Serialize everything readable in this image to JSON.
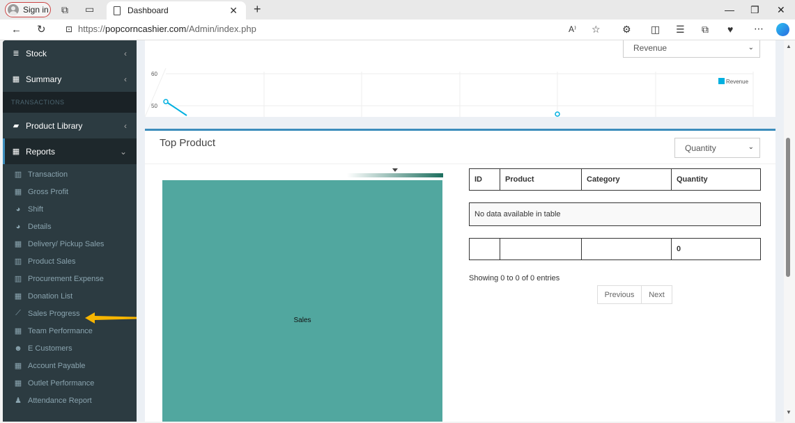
{
  "browser": {
    "sign_in_label": "Sign in",
    "tab_title": "Dashboard",
    "new_tab_symbol": "+",
    "url_prefix": "https://",
    "url_domain": "popcorncashier.com",
    "url_path": "/Admin/index.php"
  },
  "sidebar": {
    "top_items": [
      {
        "label": "Stock",
        "icon": "database-icon"
      },
      {
        "label": "Summary",
        "icon": "table-icon"
      }
    ],
    "section_header": "TRANSACTIONS",
    "product_library": {
      "label": "Product Library",
      "icon": "book-icon"
    },
    "reports": {
      "label": "Reports",
      "icon": "table-icon"
    },
    "report_items": [
      {
        "label": "Transaction",
        "icon": "bar-chart-icon"
      },
      {
        "label": "Gross Profit",
        "icon": "table-icon"
      },
      {
        "label": "Shift",
        "icon": "pie-chart-icon"
      },
      {
        "label": "Details",
        "icon": "pie-chart-icon"
      },
      {
        "label": "Delivery/ Pickup Sales",
        "icon": "table-icon"
      },
      {
        "label": "Product Sales",
        "icon": "bar-chart-icon"
      },
      {
        "label": "Procurement Expense",
        "icon": "bar-chart-icon"
      },
      {
        "label": "Donation List",
        "icon": "table-icon"
      },
      {
        "label": "Sales Progress",
        "icon": "line-chart-icon"
      },
      {
        "label": "Team Performance",
        "icon": "table-icon"
      },
      {
        "label": "E Customers",
        "icon": "users-icon"
      },
      {
        "label": "Account Payable",
        "icon": "table-icon"
      },
      {
        "label": "Outlet Performance",
        "icon": "table-icon"
      },
      {
        "label": "Attendance Report",
        "icon": "person-icon"
      }
    ]
  },
  "revenue_panel": {
    "select_value": "Revenue",
    "legend_label": "Revenue",
    "y_ticks": [
      "60",
      "50"
    ],
    "colors": {
      "line": "#00b0e0"
    }
  },
  "top_product": {
    "title": "Top Product",
    "select_value": "Quantity",
    "treemap_label": "Sales",
    "treemap_color": "#51a79f",
    "table": {
      "headers": [
        "ID",
        "Product",
        "Category",
        "Quantity"
      ],
      "empty_message": "No data available in table",
      "footer_row": [
        "",
        "",
        "",
        "0"
      ]
    },
    "info": "Showing 0 to 0 of 0 entries",
    "previous_label": "Previous",
    "next_label": "Next"
  },
  "annotation": {
    "arrow_color": "#f7b500"
  }
}
